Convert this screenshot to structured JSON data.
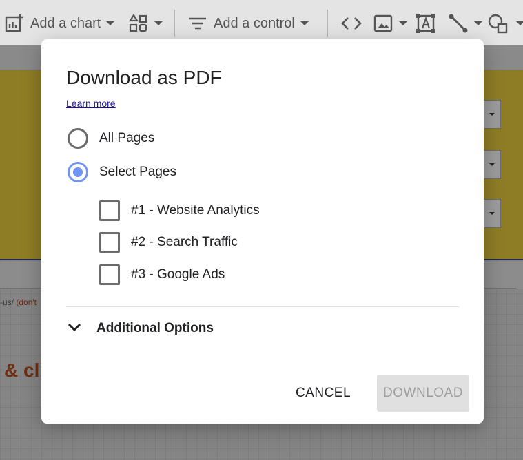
{
  "toolbar": {
    "add_chart_label": "Add a chart",
    "add_control_label": "Add a control",
    "icons": [
      "add-chart-icon",
      "community-viz-icon",
      "filter-control-icon",
      "embed-code-icon",
      "image-icon",
      "text-box-icon",
      "line-icon",
      "shape-icon"
    ]
  },
  "background": {
    "url_fragment": "-us/",
    "url_warning": "(don't",
    "heading_fragment": "& cli"
  },
  "dialog": {
    "title": "Download as PDF",
    "learn_more": "Learn more",
    "options": {
      "all_pages": {
        "label": "All Pages",
        "selected": false
      },
      "select_pages": {
        "label": "Select Pages",
        "selected": true
      }
    },
    "pages": [
      {
        "label": "#1 - Website Analytics",
        "checked": false
      },
      {
        "label": "#2 - Search Traffic",
        "checked": false
      },
      {
        "label": "#3 - Google Ads",
        "checked": false
      }
    ],
    "additional_options_label": "Additional Options",
    "cancel_label": "CANCEL",
    "download_label": "DOWNLOAD",
    "download_enabled": false
  },
  "colors": {
    "accent_radio": "#7094f4",
    "overlay_dim": "#8a8a8a",
    "banner": "#8f7d26",
    "link": "#1a0dab",
    "disabled_button": "#e0e0e0"
  }
}
